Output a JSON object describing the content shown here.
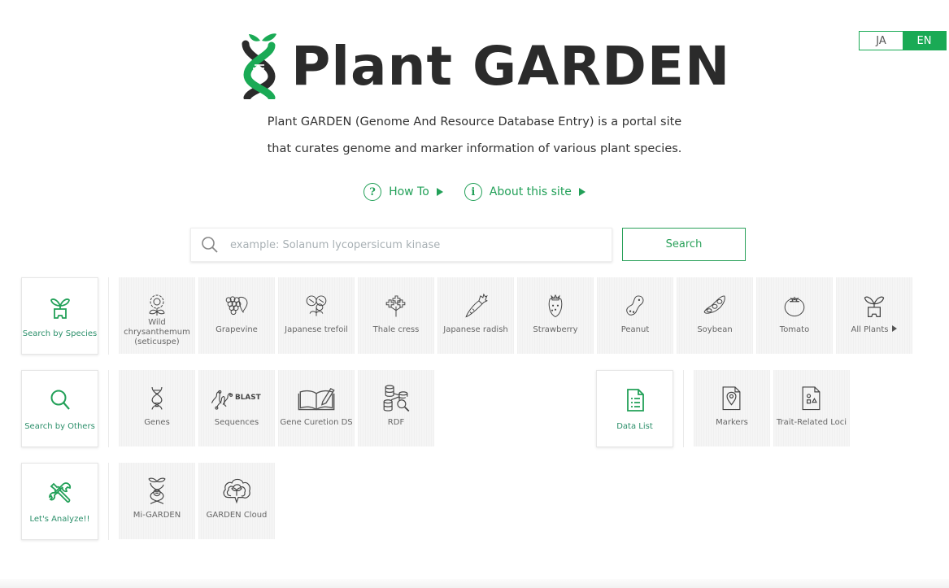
{
  "language": {
    "options": [
      "JA",
      "EN"
    ],
    "selected": "EN"
  },
  "logo": {
    "text": "Plant GARDEN",
    "icon": "dna-sprout-icon"
  },
  "description": {
    "line1": "Plant GARDEN (Genome And Resource Database Entry) is a portal site",
    "line2": "that curates genome and marker information of various plant species."
  },
  "links": [
    {
      "label": "How To",
      "icon": "question-icon",
      "glyph": "?"
    },
    {
      "label": "About this site",
      "icon": "info-icon",
      "glyph": "i"
    }
  ],
  "search": {
    "value": "",
    "placeholder": "example: Solanum lycopersicum kinase",
    "button_label": "Search"
  },
  "rows": [
    {
      "category": {
        "label": "Search by Species",
        "icon": "plant-pot-icon"
      },
      "items": [
        {
          "label": "Wild chrysanthemum (seticuspe)",
          "icon": "chrysanthemum-icon"
        },
        {
          "label": "Grapevine",
          "icon": "grape-icon"
        },
        {
          "label": "Japanese trefoil",
          "icon": "trefoil-icon"
        },
        {
          "label": "Thale cress",
          "icon": "thale-cress-icon"
        },
        {
          "label": "Japanese radish",
          "icon": "radish-icon"
        },
        {
          "label": "Strawberry",
          "icon": "strawberry-icon"
        },
        {
          "label": "Peanut",
          "icon": "peanut-icon"
        },
        {
          "label": "Soybean",
          "icon": "soybean-icon"
        },
        {
          "label": "Tomato",
          "icon": "tomato-icon"
        },
        {
          "label": "All Plants",
          "icon": "plant-pot-icon"
        }
      ]
    },
    {
      "category": {
        "label": "Search by Others",
        "icon": "search-icon"
      },
      "items": [
        {
          "label": "Genes",
          "icon": "dna-icon"
        },
        {
          "label": "Sequences",
          "icon": "blast-icon",
          "badge": "BLAST"
        },
        {
          "label": "Gene Curetion DS",
          "icon": "book-pen-icon"
        },
        {
          "label": "RDF",
          "icon": "database-search-icon"
        }
      ],
      "category2": {
        "label": "Data List",
        "icon": "document-list-icon"
      },
      "items2": [
        {
          "label": "Markers",
          "icon": "document-pin-icon"
        },
        {
          "label": "Trait-Related Loci",
          "icon": "document-shapes-icon"
        }
      ]
    },
    {
      "category": {
        "label": "Let's Analyze!!",
        "icon": "tools-icon"
      },
      "items": [
        {
          "label": "Mi-GARDEN",
          "icon": "mi-garden-icon"
        },
        {
          "label": "GARDEN Cloud",
          "icon": "cloud-sprout-icon"
        }
      ]
    }
  ],
  "colors": {
    "accent": "#1aaa55",
    "text": "#333333",
    "tile_bg": "#f5f5f5"
  }
}
